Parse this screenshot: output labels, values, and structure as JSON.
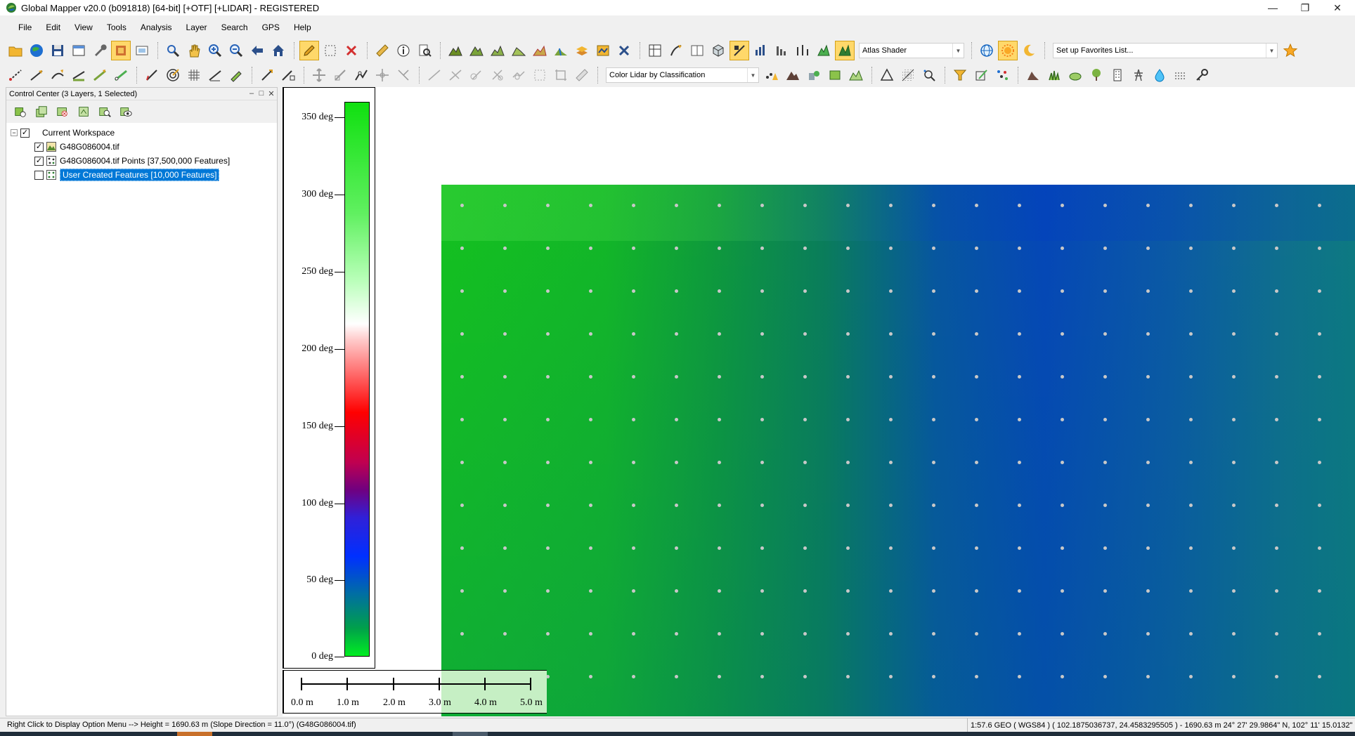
{
  "window": {
    "title": "Global Mapper v20.0 (b091818) [64-bit] [+OTF] [+LIDAR] - REGISTERED",
    "minimize_glyph": "—",
    "restore_glyph": "❐",
    "close_glyph": "✕"
  },
  "menu": [
    "File",
    "Edit",
    "View",
    "Tools",
    "Analysis",
    "Layer",
    "Search",
    "GPS",
    "Help"
  ],
  "toolbar1": {
    "shader_select": "Atlas Shader",
    "favorites_select": "Set up Favorites List..."
  },
  "toolbar2": {
    "lidar_color_select": "Color Lidar by Classification"
  },
  "control_center": {
    "title": "Control Center (3 Layers, 1 Selected)",
    "workspace_label": "Current Workspace",
    "expander_glyph": "−",
    "check_glyph": "✓",
    "layers": [
      {
        "name": "G48G086004.tif",
        "checked": true,
        "selected": false
      },
      {
        "name": "G48G086004.tif Points [37,500,000 Features]",
        "checked": true,
        "selected": false
      },
      {
        "name": "User Created Features [10,000 Features]",
        "checked": false,
        "selected": true
      }
    ]
  },
  "legend": {
    "labels": [
      "350 deg",
      "300 deg",
      "250 deg",
      "200 deg",
      "150 deg",
      "100 deg",
      "50 deg",
      "0 deg"
    ]
  },
  "scale_bar": {
    "labels": [
      "0.0 m",
      "1.0 m",
      "2.0 m",
      "3.0 m",
      "4.0 m",
      "5.0 m"
    ]
  },
  "status": {
    "left": "Right Click to Display Option Menu --> Height = 1690.63 m (Slope Direction = 11.0°) (G48G086004.tif)",
    "right": "1:57.6  GEO ( WGS84 ) ( 102.1875036737, 24.4583295505 ) - 1690.63 m  24° 27' 29.9864\" N, 102° 11' 15.0132\" E"
  },
  "colors": {
    "selection": "#0078d7",
    "active_tool": "#ffd86a"
  }
}
